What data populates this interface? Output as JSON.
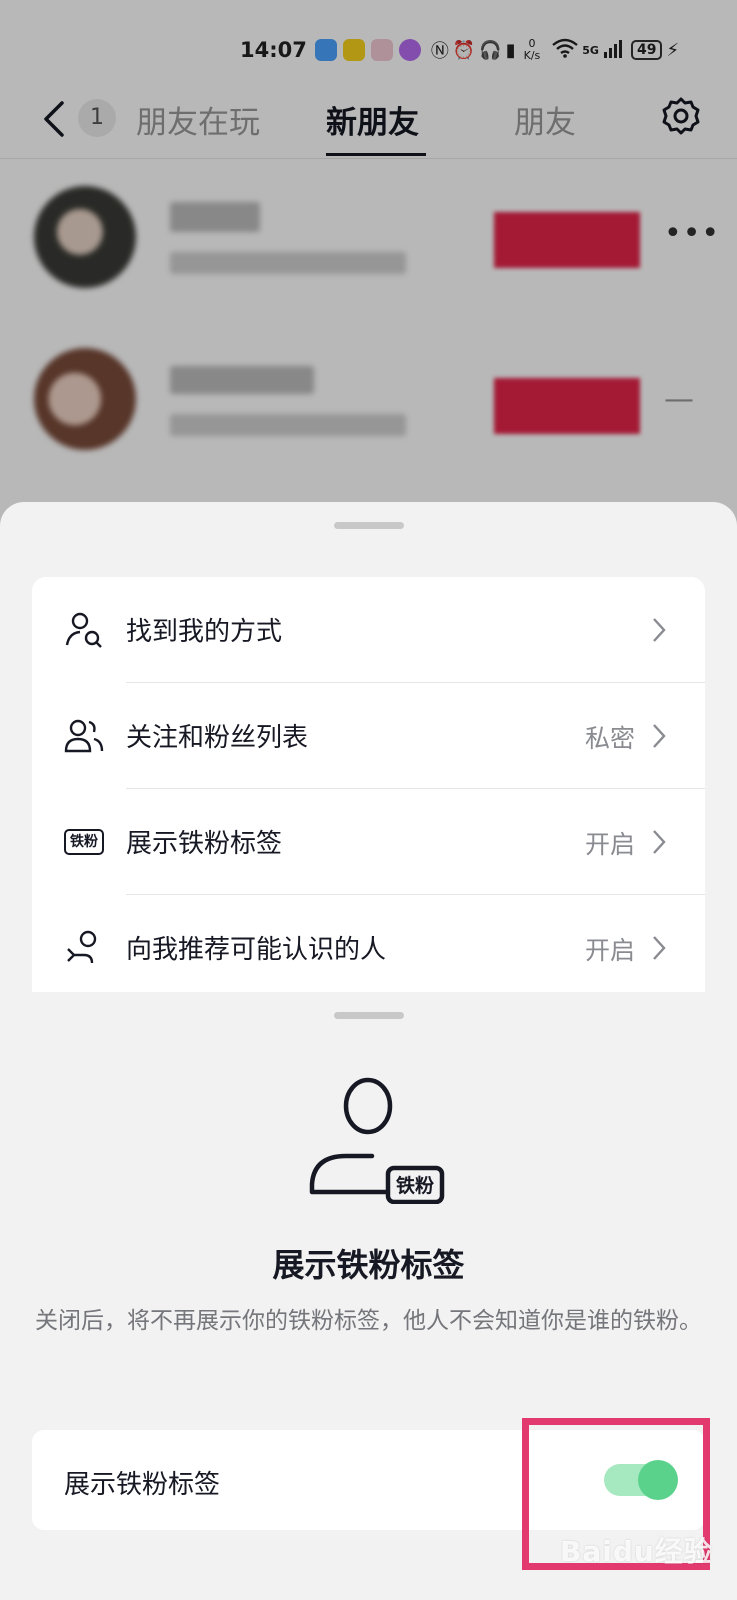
{
  "status_bar": {
    "time": "14:07",
    "net_speed_value": "0",
    "net_speed_unit": "K/s",
    "signal": "5G",
    "battery": "49",
    "app_icon_colors": [
      "#4aa3ff",
      "#f7d21e",
      "#f3c9d6",
      "#b56bf0"
    ]
  },
  "nav": {
    "badge_count": "1",
    "tabs": [
      {
        "label": "朋友在玩"
      },
      {
        "label": "新朋友"
      },
      {
        "label": "朋友"
      }
    ]
  },
  "friends_list": [
    {
      "more": "•••"
    },
    {
      "more": "—"
    }
  ],
  "privacy_menu": {
    "items": [
      {
        "label": "找到我的方式",
        "value": "",
        "icon": "person-search-icon"
      },
      {
        "label": "关注和粉丝列表",
        "value": "私密",
        "icon": "people-icon"
      },
      {
        "label": "展示铁粉标签",
        "value": "开启",
        "icon": "iron-fan-tag-icon",
        "icon_text": "铁粉"
      },
      {
        "label": "向我推荐可能认识的人",
        "value": "开启",
        "icon": "person-recommend-icon"
      }
    ]
  },
  "iron_fan_sheet": {
    "icon_tag_text": "铁粉",
    "title": "展示铁粉标签",
    "description": "关闭后，将不再展示你的铁粉标签，他人不会知道你是谁的铁粉。",
    "toggle_label": "展示铁粉标签",
    "toggle_on": true,
    "toggle_color": "#5bd28c"
  },
  "watermark": "Baidu经验",
  "highlight_color": "#e23a6f"
}
